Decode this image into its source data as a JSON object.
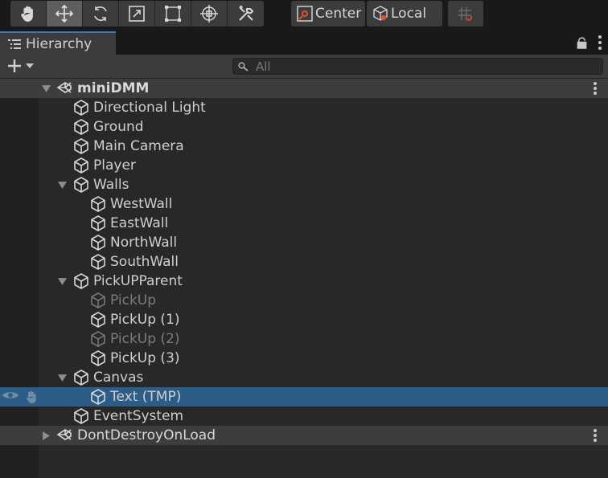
{
  "toolbar": {
    "tools": [
      {
        "name": "hand-tool-icon",
        "active": false
      },
      {
        "name": "move-tool-icon",
        "active": true
      },
      {
        "name": "rotate-tool-icon",
        "active": false
      },
      {
        "name": "scale-tool-icon",
        "active": false
      },
      {
        "name": "rect-tool-icon",
        "active": false
      },
      {
        "name": "transform-tool-icon",
        "active": false
      },
      {
        "name": "custom-tool-icon",
        "active": false
      }
    ],
    "pivot_mode_label": "Center",
    "pivot_rotation_label": "Local",
    "snap_icon": "grid-snap-icon"
  },
  "panel": {
    "tab_label": "Hierarchy",
    "lock_icon": "lock-icon",
    "menu_icon": "kebab-menu-icon"
  },
  "search": {
    "placeholder": "All",
    "value": ""
  },
  "hierarchy": {
    "scene_name": "miniDMM",
    "items": [
      {
        "label": "Directional Light",
        "depth": 1,
        "expander": "none",
        "active": true
      },
      {
        "label": "Ground",
        "depth": 1,
        "expander": "none",
        "active": true
      },
      {
        "label": "Main Camera",
        "depth": 1,
        "expander": "none",
        "active": true
      },
      {
        "label": "Player",
        "depth": 1,
        "expander": "none",
        "active": true
      },
      {
        "label": "Walls",
        "depth": 1,
        "expander": "expanded",
        "active": true
      },
      {
        "label": "WestWall",
        "depth": 2,
        "expander": "none",
        "active": true
      },
      {
        "label": "EastWall",
        "depth": 2,
        "expander": "none",
        "active": true
      },
      {
        "label": "NorthWall",
        "depth": 2,
        "expander": "none",
        "active": true
      },
      {
        "label": "SouthWall",
        "depth": 2,
        "expander": "none",
        "active": true
      },
      {
        "label": "PickUPParent",
        "depth": 1,
        "expander": "expanded",
        "active": true
      },
      {
        "label": "PickUp",
        "depth": 2,
        "expander": "none",
        "active": false
      },
      {
        "label": "PickUp (1)",
        "depth": 2,
        "expander": "none",
        "active": true
      },
      {
        "label": "PickUp (2)",
        "depth": 2,
        "expander": "none",
        "active": false
      },
      {
        "label": "PickUp (3)",
        "depth": 2,
        "expander": "none",
        "active": true
      },
      {
        "label": "Canvas",
        "depth": 1,
        "expander": "expanded",
        "active": true
      },
      {
        "label": "Text (TMP)",
        "depth": 2,
        "expander": "none",
        "active": true,
        "selected": true
      },
      {
        "label": "EventSystem",
        "depth": 1,
        "expander": "none",
        "active": true
      }
    ],
    "dont_destroy_label": "DontDestroyOnLoad"
  },
  "colors": {
    "selection": "#2c5d87",
    "tab_accent": "#3a79bb",
    "pivot_icon_accent": "#e0522c"
  }
}
